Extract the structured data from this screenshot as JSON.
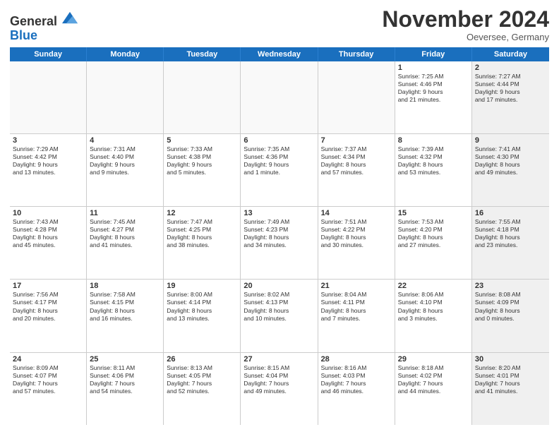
{
  "logo": {
    "line1": "General",
    "line2": "Blue"
  },
  "title": "November 2024",
  "location": "Oeversee, Germany",
  "days_header": [
    "Sunday",
    "Monday",
    "Tuesday",
    "Wednesday",
    "Thursday",
    "Friday",
    "Saturday"
  ],
  "weeks": [
    [
      {
        "day": "",
        "info": "",
        "shaded": true
      },
      {
        "day": "",
        "info": "",
        "shaded": true
      },
      {
        "day": "",
        "info": "",
        "shaded": true
      },
      {
        "day": "",
        "info": "",
        "shaded": true
      },
      {
        "day": "",
        "info": "",
        "shaded": true
      },
      {
        "day": "1",
        "info": "Sunrise: 7:25 AM\nSunset: 4:46 PM\nDaylight: 9 hours\nand 21 minutes.",
        "shaded": false
      },
      {
        "day": "2",
        "info": "Sunrise: 7:27 AM\nSunset: 4:44 PM\nDaylight: 9 hours\nand 17 minutes.",
        "shaded": true
      }
    ],
    [
      {
        "day": "3",
        "info": "Sunrise: 7:29 AM\nSunset: 4:42 PM\nDaylight: 9 hours\nand 13 minutes.",
        "shaded": false
      },
      {
        "day": "4",
        "info": "Sunrise: 7:31 AM\nSunset: 4:40 PM\nDaylight: 9 hours\nand 9 minutes.",
        "shaded": false
      },
      {
        "day": "5",
        "info": "Sunrise: 7:33 AM\nSunset: 4:38 PM\nDaylight: 9 hours\nand 5 minutes.",
        "shaded": false
      },
      {
        "day": "6",
        "info": "Sunrise: 7:35 AM\nSunset: 4:36 PM\nDaylight: 9 hours\nand 1 minute.",
        "shaded": false
      },
      {
        "day": "7",
        "info": "Sunrise: 7:37 AM\nSunset: 4:34 PM\nDaylight: 8 hours\nand 57 minutes.",
        "shaded": false
      },
      {
        "day": "8",
        "info": "Sunrise: 7:39 AM\nSunset: 4:32 PM\nDaylight: 8 hours\nand 53 minutes.",
        "shaded": false
      },
      {
        "day": "9",
        "info": "Sunrise: 7:41 AM\nSunset: 4:30 PM\nDaylight: 8 hours\nand 49 minutes.",
        "shaded": true
      }
    ],
    [
      {
        "day": "10",
        "info": "Sunrise: 7:43 AM\nSunset: 4:28 PM\nDaylight: 8 hours\nand 45 minutes.",
        "shaded": false
      },
      {
        "day": "11",
        "info": "Sunrise: 7:45 AM\nSunset: 4:27 PM\nDaylight: 8 hours\nand 41 minutes.",
        "shaded": false
      },
      {
        "day": "12",
        "info": "Sunrise: 7:47 AM\nSunset: 4:25 PM\nDaylight: 8 hours\nand 38 minutes.",
        "shaded": false
      },
      {
        "day": "13",
        "info": "Sunrise: 7:49 AM\nSunset: 4:23 PM\nDaylight: 8 hours\nand 34 minutes.",
        "shaded": false
      },
      {
        "day": "14",
        "info": "Sunrise: 7:51 AM\nSunset: 4:22 PM\nDaylight: 8 hours\nand 30 minutes.",
        "shaded": false
      },
      {
        "day": "15",
        "info": "Sunrise: 7:53 AM\nSunset: 4:20 PM\nDaylight: 8 hours\nand 27 minutes.",
        "shaded": false
      },
      {
        "day": "16",
        "info": "Sunrise: 7:55 AM\nSunset: 4:18 PM\nDaylight: 8 hours\nand 23 minutes.",
        "shaded": true
      }
    ],
    [
      {
        "day": "17",
        "info": "Sunrise: 7:56 AM\nSunset: 4:17 PM\nDaylight: 8 hours\nand 20 minutes.",
        "shaded": false
      },
      {
        "day": "18",
        "info": "Sunrise: 7:58 AM\nSunset: 4:15 PM\nDaylight: 8 hours\nand 16 minutes.",
        "shaded": false
      },
      {
        "day": "19",
        "info": "Sunrise: 8:00 AM\nSunset: 4:14 PM\nDaylight: 8 hours\nand 13 minutes.",
        "shaded": false
      },
      {
        "day": "20",
        "info": "Sunrise: 8:02 AM\nSunset: 4:13 PM\nDaylight: 8 hours\nand 10 minutes.",
        "shaded": false
      },
      {
        "day": "21",
        "info": "Sunrise: 8:04 AM\nSunset: 4:11 PM\nDaylight: 8 hours\nand 7 minutes.",
        "shaded": false
      },
      {
        "day": "22",
        "info": "Sunrise: 8:06 AM\nSunset: 4:10 PM\nDaylight: 8 hours\nand 3 minutes.",
        "shaded": false
      },
      {
        "day": "23",
        "info": "Sunrise: 8:08 AM\nSunset: 4:09 PM\nDaylight: 8 hours\nand 0 minutes.",
        "shaded": true
      }
    ],
    [
      {
        "day": "24",
        "info": "Sunrise: 8:09 AM\nSunset: 4:07 PM\nDaylight: 7 hours\nand 57 minutes.",
        "shaded": false
      },
      {
        "day": "25",
        "info": "Sunrise: 8:11 AM\nSunset: 4:06 PM\nDaylight: 7 hours\nand 54 minutes.",
        "shaded": false
      },
      {
        "day": "26",
        "info": "Sunrise: 8:13 AM\nSunset: 4:05 PM\nDaylight: 7 hours\nand 52 minutes.",
        "shaded": false
      },
      {
        "day": "27",
        "info": "Sunrise: 8:15 AM\nSunset: 4:04 PM\nDaylight: 7 hours\nand 49 minutes.",
        "shaded": false
      },
      {
        "day": "28",
        "info": "Sunrise: 8:16 AM\nSunset: 4:03 PM\nDaylight: 7 hours\nand 46 minutes.",
        "shaded": false
      },
      {
        "day": "29",
        "info": "Sunrise: 8:18 AM\nSunset: 4:02 PM\nDaylight: 7 hours\nand 44 minutes.",
        "shaded": false
      },
      {
        "day": "30",
        "info": "Sunrise: 8:20 AM\nSunset: 4:01 PM\nDaylight: 7 hours\nand 41 minutes.",
        "shaded": true
      }
    ]
  ]
}
